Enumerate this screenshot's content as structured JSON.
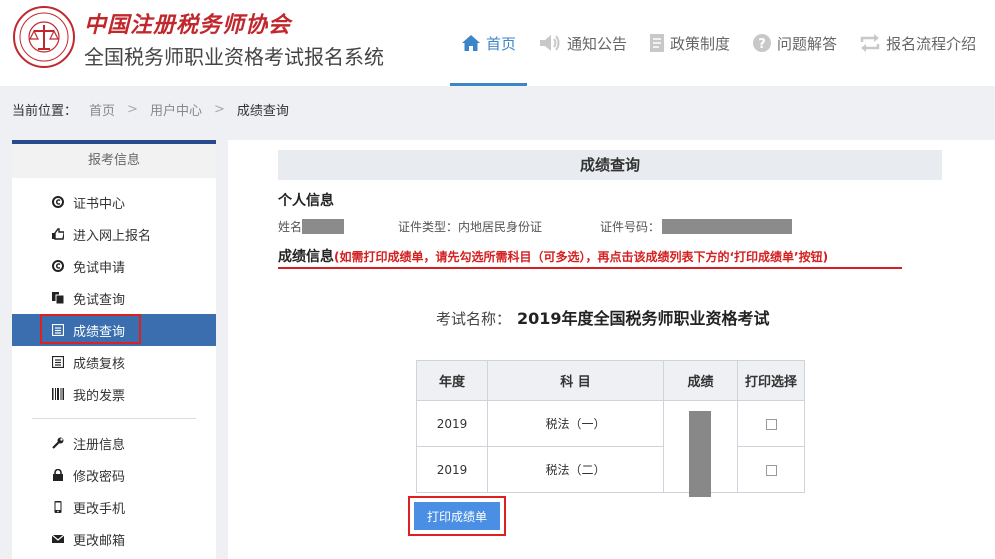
{
  "header": {
    "brand_title": "中国注册税务师协会",
    "brand_subtitle": "全国税务师职业资格考试报名系统",
    "nav": [
      {
        "label": "首页",
        "icon": "home-icon"
      },
      {
        "label": "通知公告",
        "icon": "speaker-icon"
      },
      {
        "label": "政策制度",
        "icon": "document-icon"
      },
      {
        "label": "问题解答",
        "icon": "question-icon"
      },
      {
        "label": "报名流程介绍",
        "icon": "flow-icon"
      }
    ]
  },
  "breadcrumb": {
    "label": "当前位置：",
    "items": [
      "首页",
      "用户中心",
      "成绩查询"
    ]
  },
  "sidebar": {
    "title": "报考信息",
    "items": [
      {
        "label": "证书中心",
        "icon": "circle-c-icon"
      },
      {
        "label": "进入网上报名",
        "icon": "hand-point-icon"
      },
      {
        "label": "免试申请",
        "icon": "circle-c-icon"
      },
      {
        "label": "免试查询",
        "icon": "copy-icon"
      },
      {
        "label": "成绩查询",
        "icon": "list-icon",
        "active": true
      },
      {
        "label": "成绩复核",
        "icon": "list-icon"
      },
      {
        "label": "我的发票",
        "icon": "barcode-icon"
      }
    ],
    "items2": [
      {
        "label": "注册信息",
        "icon": "wrench-icon"
      },
      {
        "label": "修改密码",
        "icon": "lock-icon"
      },
      {
        "label": "更改手机",
        "icon": "phone-icon"
      },
      {
        "label": "更改邮箱",
        "icon": "mail-icon"
      }
    ]
  },
  "main": {
    "section_title": "成绩查询",
    "personal_title": "个人信息",
    "name_label": "姓名",
    "id_type_label": "证件类型：",
    "id_type_value": "内地居民身份证",
    "id_no_label": "证件号码：",
    "score_info_title": "成绩信息",
    "score_info_tip": "(如需打印成绩单，请先勾选所需科目（可多选），再点击该成绩列表下方的‘打印成绩单’按钮)",
    "exam_label": "考试名称：",
    "exam_value": "2019年度全国税务师职业资格考试",
    "table": {
      "headers": [
        "年度",
        "科  目",
        "成绩",
        "打印选择"
      ],
      "rows": [
        {
          "year": "2019",
          "subject": "税法（一）"
        },
        {
          "year": "2019",
          "subject": "税法（二）"
        }
      ]
    },
    "print_label": "打印成绩单"
  },
  "colors": {
    "accent": "#3d84c8",
    "brand_red": "#c0282d",
    "sidebar_active": "#3a6eaf",
    "highlight_red": "#e02020",
    "button_blue": "#4a8fe3"
  }
}
